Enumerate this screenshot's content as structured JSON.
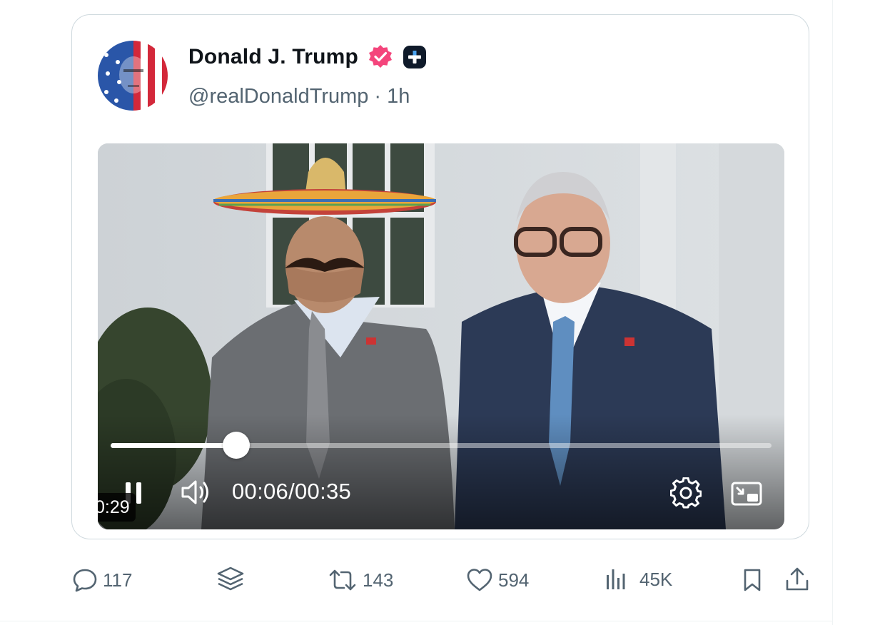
{
  "post": {
    "author": {
      "display_name": "Donald J. Trump",
      "handle": "@realDonaldTrump",
      "separator": "·",
      "time": "1h",
      "verified_color": "#f4457c"
    },
    "video": {
      "current_time": "00:06",
      "time_separator": "/",
      "total_time": "00:35",
      "progress": 0.19,
      "remaining_badge": "0:29",
      "state": "playing"
    },
    "actions": {
      "replies": "117",
      "retruths": "143",
      "likes": "594",
      "views": "45K"
    }
  },
  "icons": {
    "verified": "verified-badge-icon",
    "plus": "plus-badge-icon",
    "pause": "pause-icon",
    "volume": "volume-icon",
    "settings": "gear-icon",
    "pip": "picture-in-picture-icon",
    "reply": "speech-bubble-icon",
    "layers": "layers-icon",
    "retruth": "repost-icon",
    "like": "heart-icon",
    "views": "bar-chart-icon",
    "bookmark": "bookmark-icon",
    "share": "share-icon"
  }
}
